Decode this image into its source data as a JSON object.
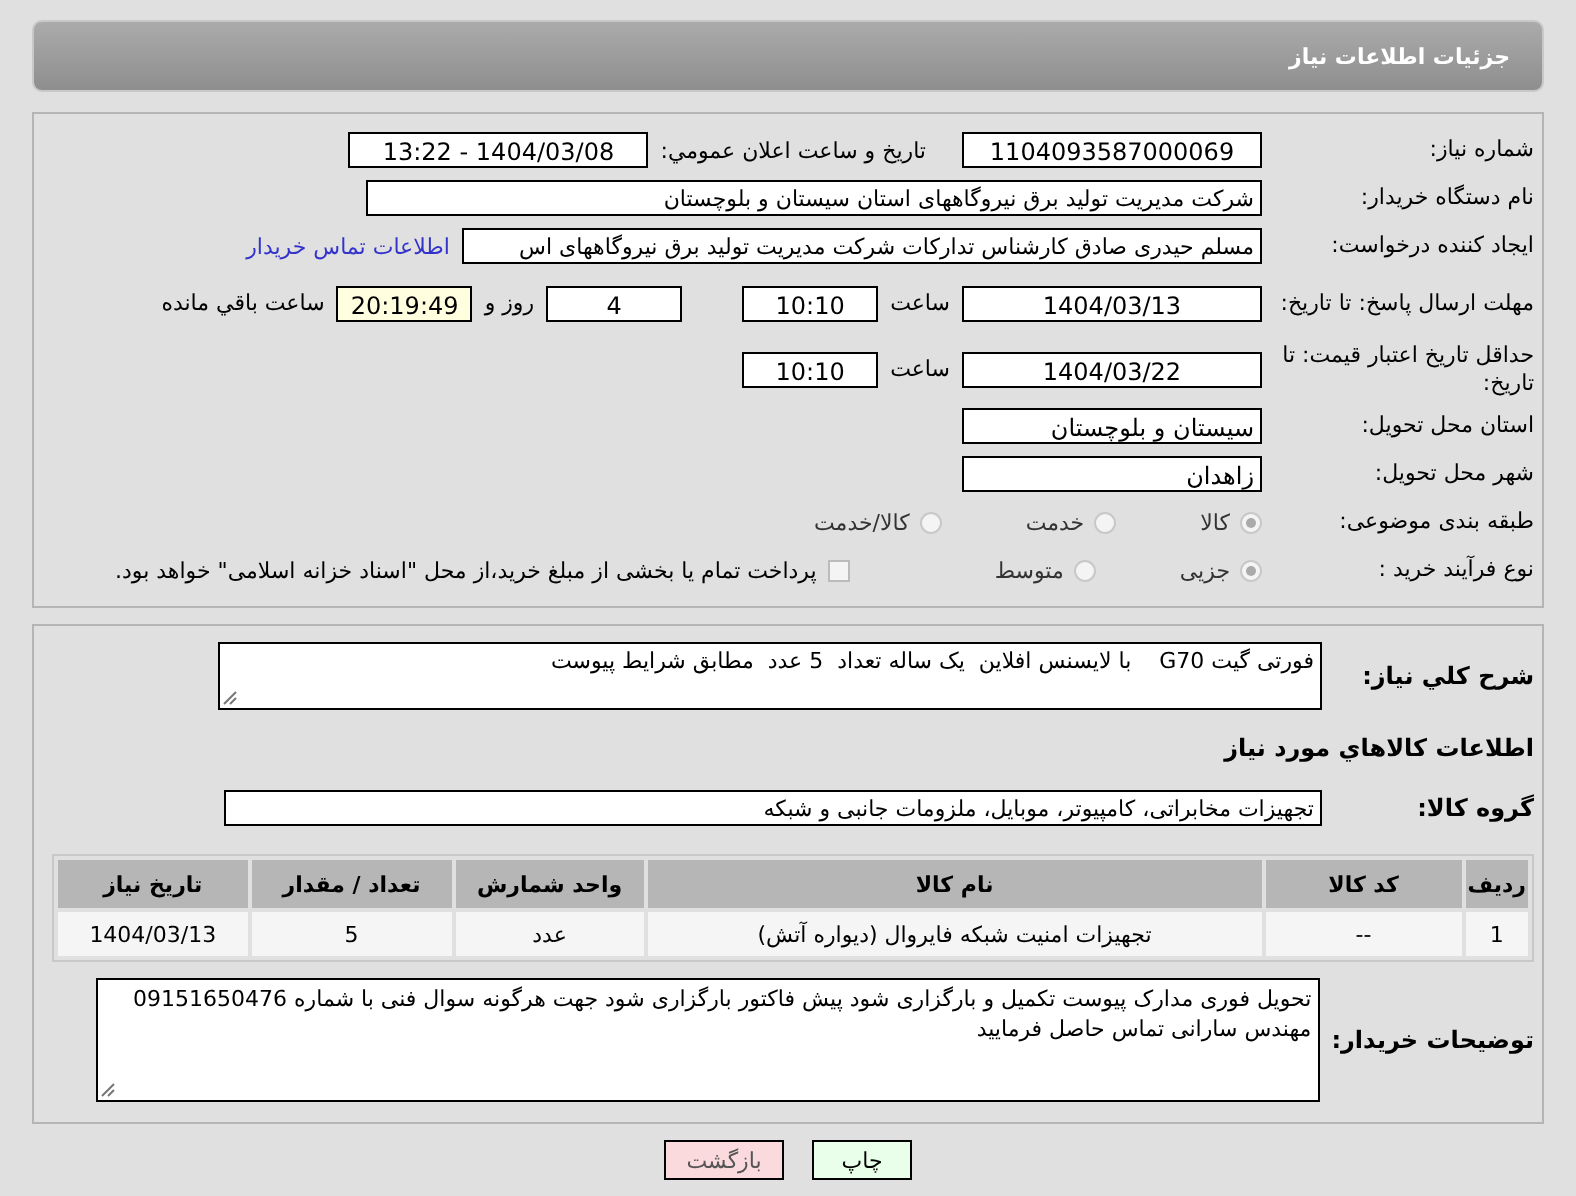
{
  "header": {
    "title": "جزئیات اطلاعات نیاز"
  },
  "need_number": {
    "label": "شماره نیاز:",
    "value": "1104093587000069"
  },
  "announce": {
    "label": "تاریخ و ساعت اعلان عمومي:",
    "value": "1404/03/08 - 13:22"
  },
  "buyer_org": {
    "label": "نام دستگاه خریدار:",
    "value": "شرکت مدیریت تولید برق نیروگاههای استان سیستان و بلوچستان"
  },
  "requester": {
    "label": "ایجاد کننده درخواست:",
    "value": "مسلم حیدری صادق کارشناس تدارکات شرکت مدیریت تولید برق نیروگاههای اس",
    "link": "اطلاعات تماس خریدار"
  },
  "reply_deadline": {
    "label": "مهلت ارسال پاسخ: تا تاریخ:",
    "date": "1404/03/13",
    "time_label": "ساعت",
    "time": "10:10",
    "days": "4",
    "days_label": "روز و",
    "remaining": "20:19:49",
    "remaining_label": "ساعت باقي مانده"
  },
  "price_validity": {
    "label": "حداقل تاریخ اعتبار قیمت: تا تاریخ:",
    "date": "1404/03/22",
    "time_label": "ساعت",
    "time": "10:10"
  },
  "province": {
    "label": "استان محل تحویل:",
    "value": "سیستان و بلوچستان"
  },
  "city": {
    "label": "شهر محل تحویل:",
    "value": "زاهدان"
  },
  "category": {
    "label": "طبقه بندی موضوعی:",
    "disabled": true,
    "options": [
      {
        "label": "کالا",
        "selected": true
      },
      {
        "label": "خدمت",
        "selected": false
      },
      {
        "label": "کالا/خدمت",
        "selected": false
      }
    ]
  },
  "purchase_type": {
    "label": "نوع فرآیند خرید :",
    "disabled": true,
    "options": [
      {
        "label": "جزیی",
        "selected": true
      },
      {
        "label": "متوسط",
        "selected": false
      }
    ],
    "treasury": {
      "checked": false,
      "label": "پرداخت تمام یا بخشی از مبلغ خرید،از محل \"اسناد خزانه اسلامی\" خواهد بود."
    }
  },
  "description": {
    "label": "شرح کلي نیاز:",
    "value": "فورتی گیت G70    با لایسنس افلاین  یک ساله تعداد  5 عدد  مطابق شرایط پیوست"
  },
  "goods_heading": "اطلاعات کالاهاي مورد نیاز",
  "goods_group": {
    "label": "گروه کالا:",
    "value": "تجهیزات مخابراتی، کامپیوتر، موبایل، ملزومات جانبی و شبکه"
  },
  "table": {
    "columns": [
      "ردیف",
      "کد کالا",
      "نام کالا",
      "واحد شمارش",
      "تعداد / مقدار",
      "تاریخ نیاز"
    ],
    "rows": [
      [
        "1",
        "--",
        "تجهیزات امنیت شبکه فایروال (دیواره آتش)",
        "عدد",
        "5",
        "1404/03/13"
      ]
    ]
  },
  "buyer_notes": {
    "label": "توضیحات خریدار:",
    "value": "تحویل فوری  مدارک پیوست تکمیل و بارگزاری شود پیش فاکتور بارگزاری شود جهت هرگونه سوال فنی با شماره 09151650476 مهندس سارانی تماس حاصل فرمایید"
  },
  "buttons": [
    {
      "label": "چاپ",
      "kind": "print"
    },
    {
      "label": "بازگشت",
      "kind": "back"
    }
  ]
}
